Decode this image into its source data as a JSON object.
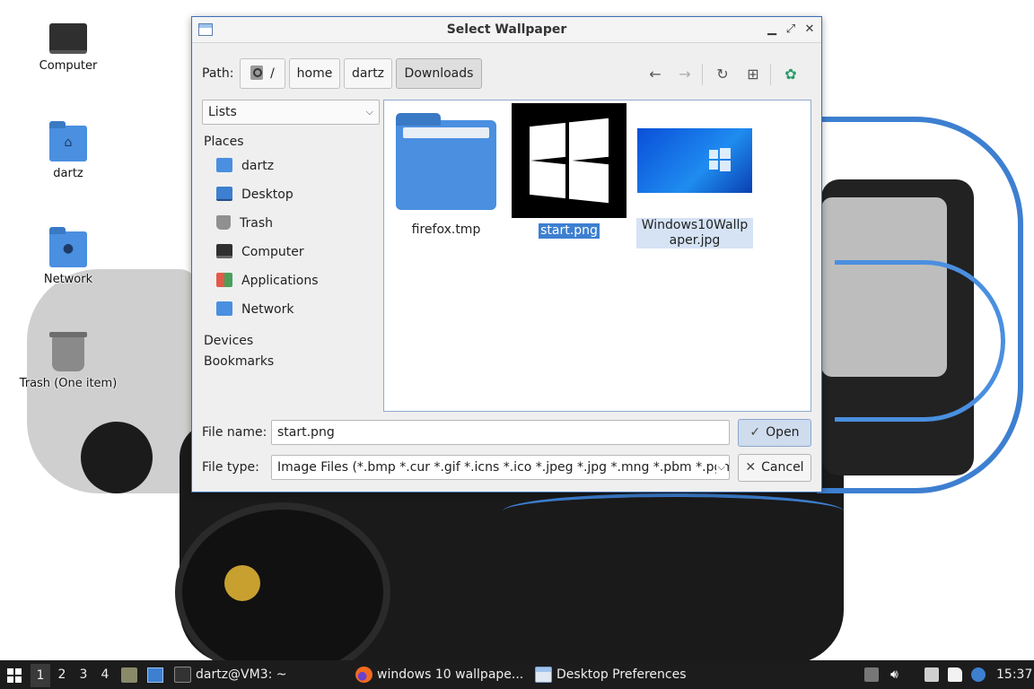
{
  "desktop": {
    "icons": [
      {
        "label": "Computer"
      },
      {
        "label": "dartz"
      },
      {
        "label": "Network"
      },
      {
        "label": "Trash (One item)"
      }
    ]
  },
  "dialog": {
    "title": "Select Wallpaper",
    "path_label": "Path:",
    "breadcrumbs": [
      "/",
      "home",
      "dartz",
      "Downloads"
    ],
    "view_mode": "Lists",
    "sections": {
      "places": "Places",
      "devices": "Devices",
      "bookmarks": "Bookmarks"
    },
    "places": [
      {
        "label": "dartz",
        "icon": "home-folder-icon"
      },
      {
        "label": "Desktop",
        "icon": "desktop-icon"
      },
      {
        "label": "Trash",
        "icon": "trash-icon"
      },
      {
        "label": "Computer",
        "icon": "computer-icon"
      },
      {
        "label": "Applications",
        "icon": "applications-icon"
      },
      {
        "label": "Network",
        "icon": "network-icon"
      }
    ],
    "files": [
      {
        "name": "firefox.tmp",
        "type": "folder"
      },
      {
        "name": "start.png",
        "type": "image",
        "selected": true
      },
      {
        "name": "Windows10Wallpaper.jpg",
        "type": "image"
      }
    ],
    "file_name_label": "File name:",
    "file_name_value": "start.png",
    "file_type_label": "File type:",
    "file_type_value": "Image Files (*.bmp *.cur *.gif *.icns *.ico *.jpeg *.jpg *.mng *.pbm *.pgm",
    "open_label": "Open",
    "cancel_label": "Cancel"
  },
  "taskbar": {
    "workspaces": [
      "1",
      "2",
      "3",
      "4"
    ],
    "active_workspace": "1",
    "tasks": [
      {
        "label": "dartz@VM3: ~"
      },
      {
        "label": "windows 10 wallpape..."
      },
      {
        "label": "Desktop Preferences"
      }
    ],
    "clock": "15:37"
  },
  "colors": {
    "accent": "#3d7fd0",
    "folder": "#4a8fe0",
    "taskbar": "#1c1c1c"
  }
}
